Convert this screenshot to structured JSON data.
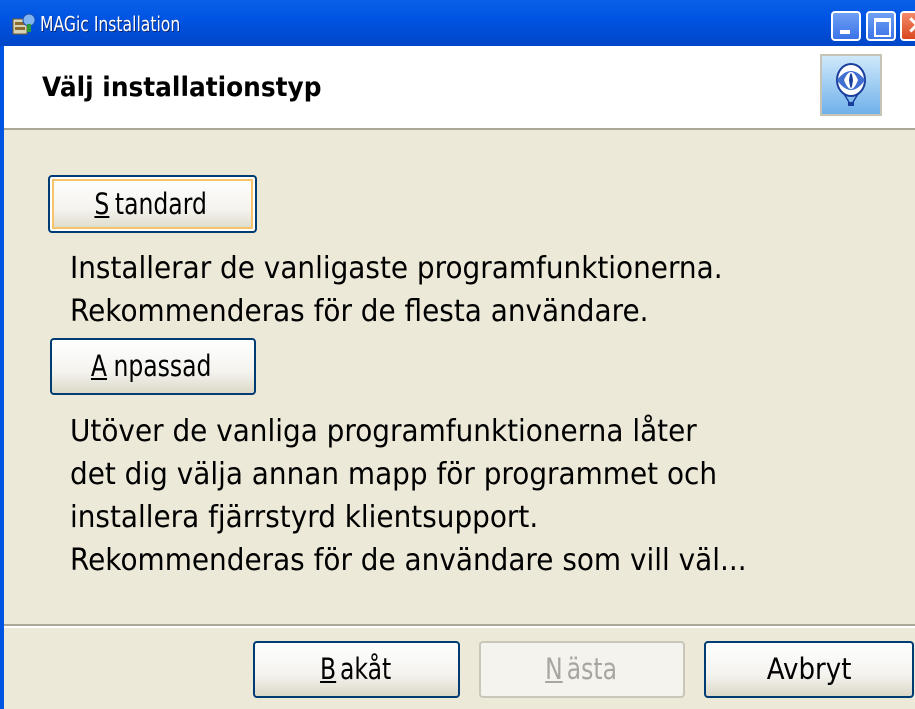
{
  "window": {
    "title": "MAGic Installation",
    "app_icon": "installer-icon",
    "controls": {
      "minimize": "minimize-icon",
      "maximize": "maximize-icon",
      "close": "close-icon"
    }
  },
  "header": {
    "title": "Välj installationstyp",
    "logo": "balloon-logo"
  },
  "options": {
    "standard": {
      "access_key": "S",
      "label_rest": "tandard",
      "description": [
        "Installerar de vanligaste programfunktionerna.",
        "Rekommenderas för de flesta användare."
      ]
    },
    "custom": {
      "access_key": "A",
      "label_rest": "npassad",
      "description": [
        "Utöver de vanliga programfunktionerna låter",
        "det dig välja annan mapp för programmet och",
        "installera fjärrstyrd klientsupport.",
        "Rekommenderas för de användare som vill väl..."
      ]
    }
  },
  "nav": {
    "back": {
      "access_key": "B",
      "label_rest": "akåt"
    },
    "next": {
      "access_key": "N",
      "label_rest": "ästa",
      "enabled": false
    },
    "cancel": {
      "label": "Avbryt"
    }
  },
  "colors": {
    "titlebar": "#0054e3",
    "dialog_bg": "#ece9d8",
    "button_border": "#003c74",
    "disabled_text": "#a7a6a0"
  }
}
